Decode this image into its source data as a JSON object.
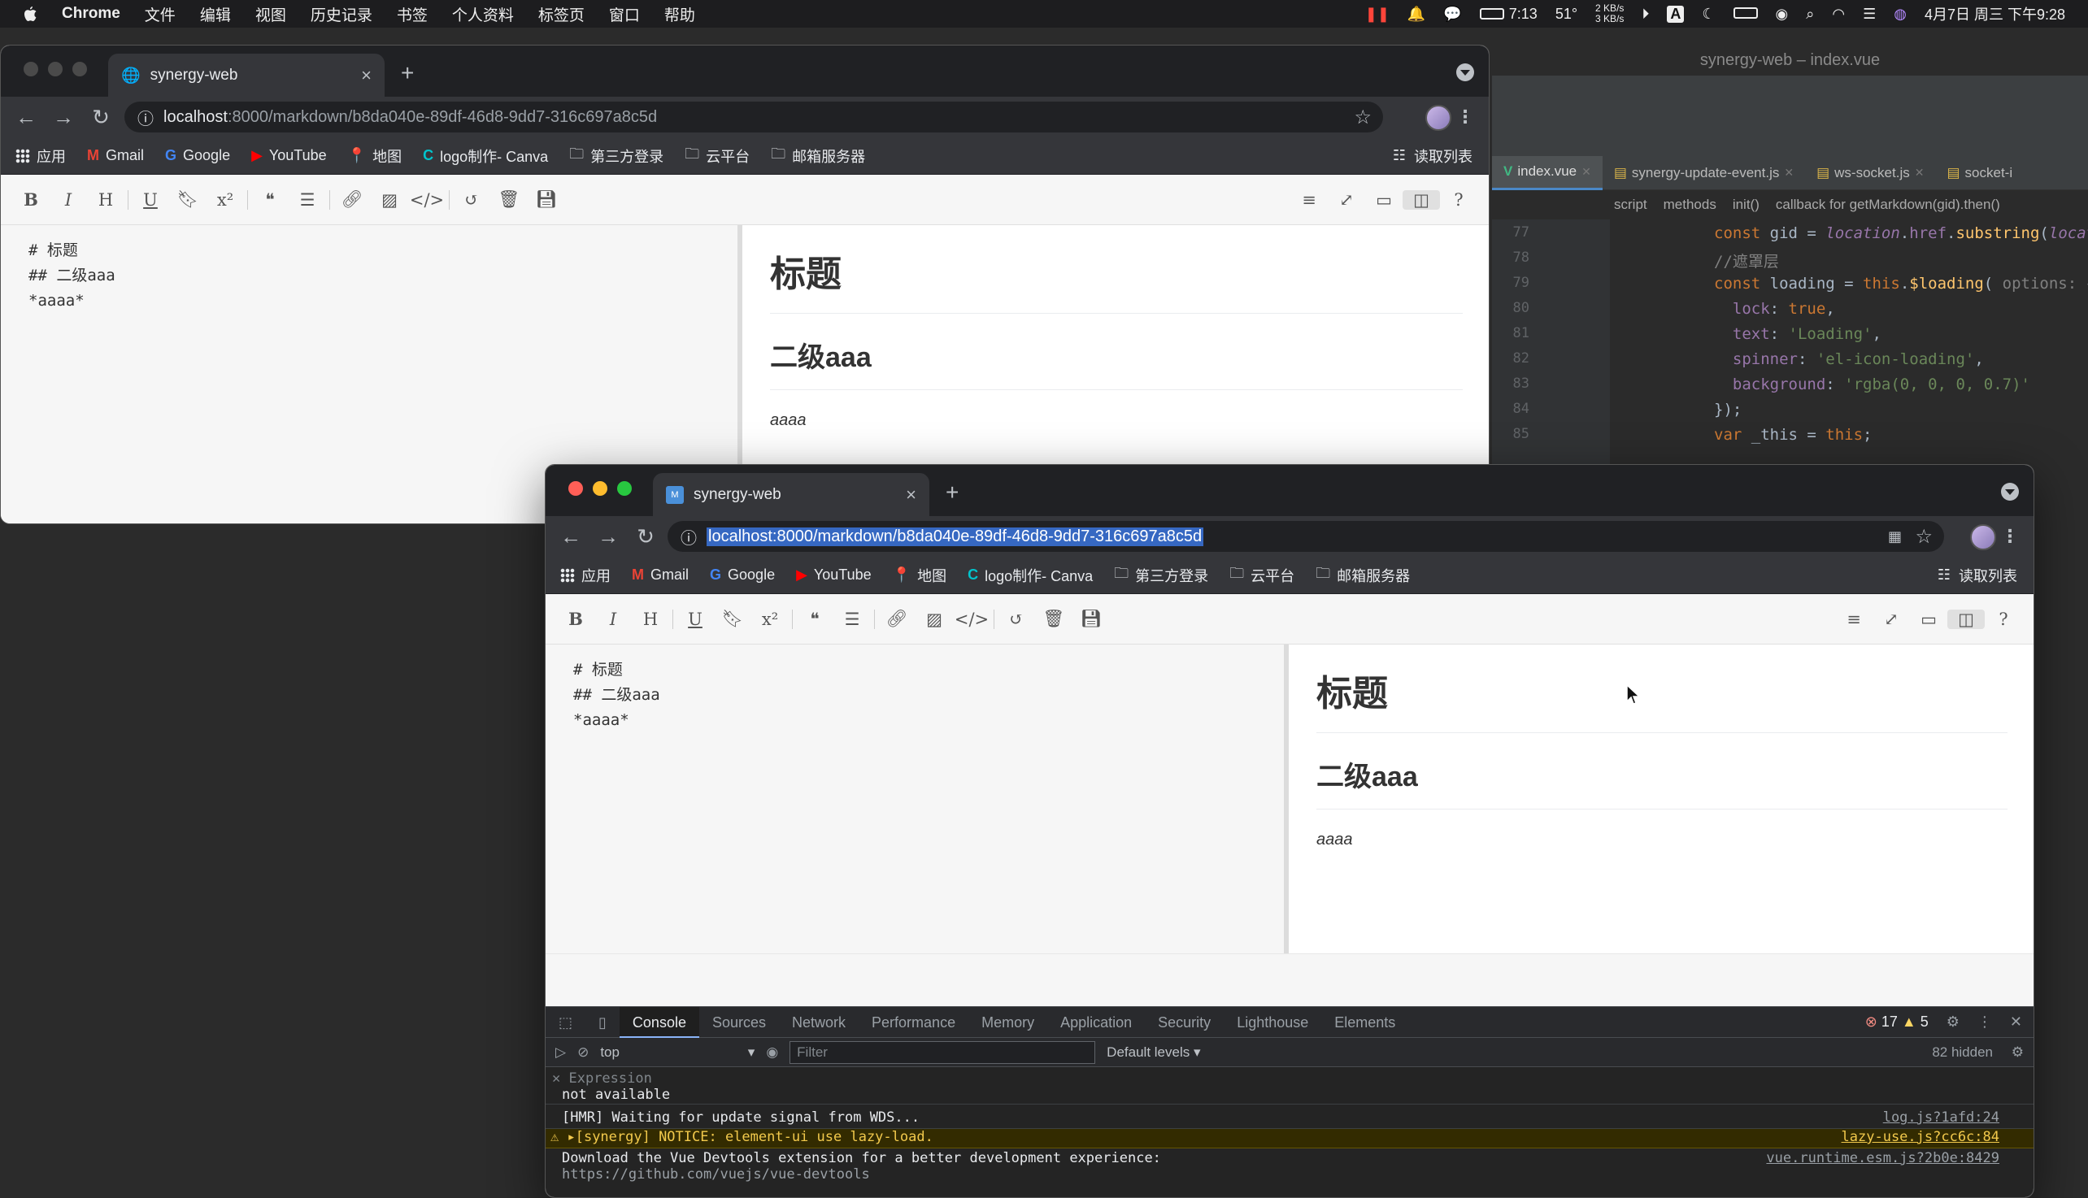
{
  "menubar": {
    "app": "Chrome",
    "items": [
      "文件",
      "编辑",
      "视图",
      "历史记录",
      "书签",
      "个人资料",
      "标签页",
      "窗口",
      "帮助"
    ],
    "battery_time": "7:13",
    "temperature": "51°",
    "net_up": "2 KB/s",
    "net_down": "3 KB/s",
    "clock": "4月7日 周三 下午9:28"
  },
  "ide": {
    "title": "synergy-web – index.vue",
    "tabs": [
      {
        "label": "index.vue",
        "active": true
      },
      {
        "label": "synergy-update-event.js",
        "active": false
      },
      {
        "label": "ws-socket.js",
        "active": false
      },
      {
        "label": "socket-i",
        "active": false
      }
    ],
    "breadcrumbs": [
      "script",
      "methods",
      "init()",
      "callback for getMarkdown(gid).then()"
    ],
    "lines": [
      {
        "n": "77",
        "html": "<span class='kw'>const</span> gid = <span class='pr it'>location</span>.<span class='pr'>href</span>.<span class='fn'>substring</span>(<span class='pr it'>location</span>."
      },
      {
        "n": "78",
        "html": "<span class='cm'>//遮罩层</span>"
      },
      {
        "n": "79",
        "html": "<span class='kw'>const</span> loading = <span class='kw'>this</span>.<span class='fn'>$loading</span>( <span class='cm'>options:</span> {"
      },
      {
        "n": "80",
        "html": "  <span class='pr'>lock</span>: <span class='kw'>true</span>,"
      },
      {
        "n": "81",
        "html": "  <span class='pr'>text</span>: <span class='st'>'Loading'</span>,"
      },
      {
        "n": "82",
        "html": "  <span class='pr'>spinner</span>: <span class='st'>'el-icon-loading'</span>,"
      },
      {
        "n": "83",
        "html": "  <span class='pr'>background</span>: <span class='st'>'rgba(0, 0, 0, 0.7)'</span>"
      },
      {
        "n": "84",
        "html": "});"
      },
      {
        "n": "85",
        "html": "<span class='kw'>var</span> _this = <span class='kw'>this</span>;"
      }
    ]
  },
  "browser": {
    "tab_title": "synergy-web",
    "url_host": "localhost",
    "url_path": ":8000/markdown/b8da040e-89df-46d8-9dd7-316c697a8c5d",
    "url_full": "localhost:8000/markdown/b8da040e-89df-46d8-9dd7-316c697a8c5d",
    "bookmarks": [
      "应用",
      "Gmail",
      "Google",
      "YouTube",
      "地图",
      "logo制作- Canva",
      "第三方登录",
      "云平台",
      "邮箱服务器"
    ],
    "reading_list": "读取列表"
  },
  "editor": {
    "source_lines": [
      "# 标题",
      "## 二级aaa",
      "*aaaa*"
    ],
    "preview": {
      "h1": "标题",
      "h2": "二级aaa",
      "em": "aaaa"
    },
    "toolbar_left": [
      "B",
      "I",
      "H",
      "U",
      "bookmark",
      "x²",
      "quote",
      "list",
      "link",
      "image",
      "code",
      "undo",
      "trash",
      "save"
    ],
    "toolbar_right": [
      "menu",
      "fullscreen",
      "window",
      "split",
      "help"
    ]
  },
  "devtools": {
    "tabs": [
      "Console",
      "Sources",
      "Network",
      "Performance",
      "Memory",
      "Application",
      "Security",
      "Lighthouse",
      "Elements"
    ],
    "active_tab": "Console",
    "errors": "17",
    "warnings": "5",
    "context": "top",
    "filter_placeholder": "Filter",
    "levels": "Default levels ▾",
    "hidden": "82 hidden",
    "expression_label": "Expression",
    "expression_value": "not available",
    "messages": [
      {
        "text": "[HMR] Waiting for update signal from WDS...",
        "source": "log.js?1afd:24",
        "level": "info"
      },
      {
        "text": "▸[synergy] NOTICE: element-ui use lazy-load.",
        "source": "lazy-use.js?cc6c:84",
        "level": "warn"
      },
      {
        "text": "Download the Vue Devtools extension for a better development experience:",
        "source": "vue.runtime.esm.js?2b0e:8429",
        "level": "info"
      },
      {
        "text": "https://github.com/vuejs/vue-devtools",
        "source": "",
        "level": "info"
      }
    ]
  },
  "colors": {
    "accent": "#8ab4f8",
    "selection": "#3668c2",
    "close": "#ff5f57",
    "minimize": "#febc2e",
    "zoom": "#28c840"
  }
}
